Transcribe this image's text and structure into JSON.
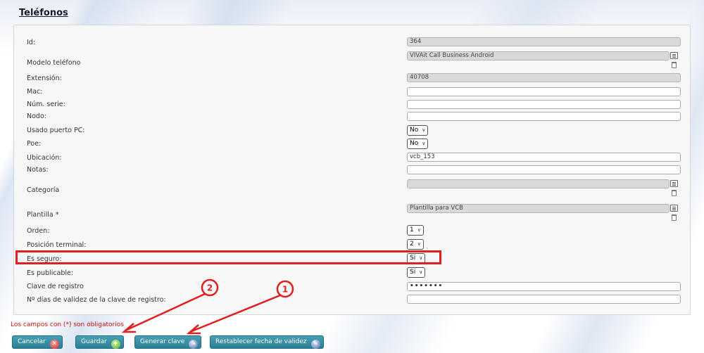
{
  "page": {
    "title": "Teléfonos"
  },
  "fields": {
    "id": {
      "label": "Id:",
      "value": "364"
    },
    "modelo": {
      "label": "Modelo teléfono",
      "value": "VIVAit Call Business Android"
    },
    "extension": {
      "label": "Extensión:",
      "value": "40708"
    },
    "mac": {
      "label": "Mac:",
      "value": ""
    },
    "serie": {
      "label": "Núm. serie:",
      "value": ""
    },
    "nodo": {
      "label": "Nodo:",
      "value": ""
    },
    "puerto_pc": {
      "label": "Usado puerto PC:",
      "value": "No"
    },
    "poe": {
      "label": "Poe:",
      "value": "No"
    },
    "ubicacion": {
      "label": "Ubicación:",
      "value": "vcb_153"
    },
    "notas": {
      "label": "Notas:",
      "value": ""
    },
    "categoria": {
      "label": "Categoría",
      "value": ""
    },
    "plantilla": {
      "label": "Plantilla *",
      "value": "Plantilla para VCB"
    },
    "orden": {
      "label": "Orden:",
      "value": "1"
    },
    "posicion": {
      "label": "Posición terminal:",
      "value": "2"
    },
    "seguro": {
      "label": "Es seguro:",
      "value": "Si"
    },
    "publicable": {
      "label": "Es publicable:",
      "value": "Si"
    },
    "clave": {
      "label": "Clave de registro",
      "value": "•••••••"
    },
    "dias_validez": {
      "label": "Nº días de validez de la clave de registro:",
      "value": ""
    }
  },
  "required_note": "Los campos con (*) son obligatorios",
  "buttons": {
    "cancel": "Cancelar",
    "save": "Guardar",
    "generate": "Generar clave",
    "reset_date": "Restablecer fecha de validez"
  },
  "annotations": {
    "marker_1": "1",
    "marker_2": "2",
    "color": "#e02020"
  },
  "icons": [
    "list-icon",
    "trash-icon",
    "cancel-icon",
    "save-icon",
    "key-icon"
  ]
}
